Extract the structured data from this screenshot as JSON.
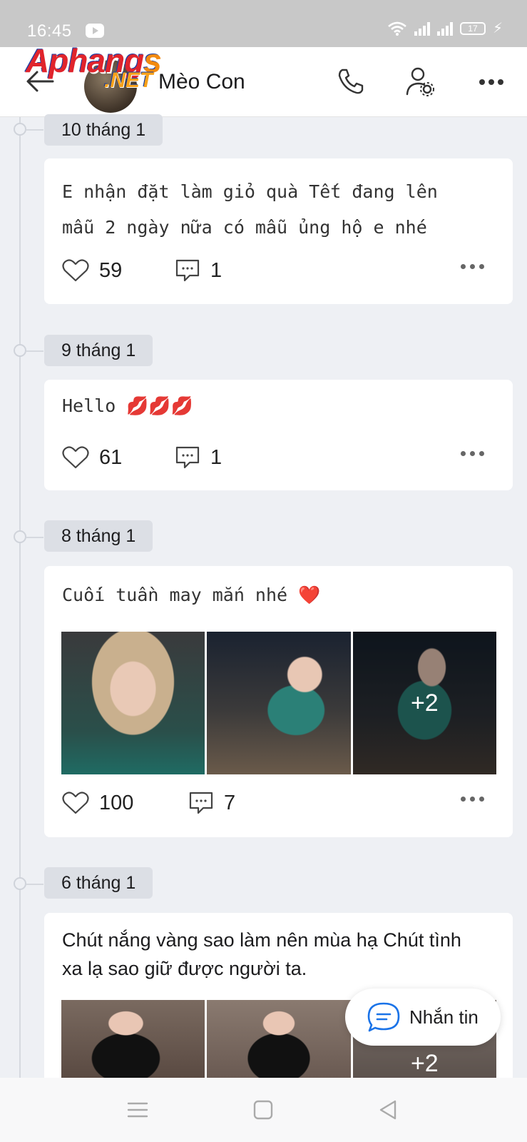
{
  "status_bar": {
    "time": "16:45",
    "battery": "17",
    "icons": [
      "youtube-icon",
      "wifi-icon",
      "signal-icon",
      "signal-icon",
      "battery-icon",
      "charging-icon"
    ]
  },
  "header": {
    "profile_name": "Mèo Con",
    "icons": [
      "back-arrow-icon",
      "phone-icon",
      "user-settings-icon",
      "more-icon"
    ]
  },
  "watermark": {
    "main": "Aphang",
    "s": "s",
    "net": ".NET"
  },
  "posts": [
    {
      "date": "10 tháng 1",
      "text": "E nhận đặt làm giỏ quà Tết đang lên\nmẫu 2 ngày nữa có mẫu ủng hộ e nhé",
      "likes": "59",
      "comments": "1"
    },
    {
      "date": "9 tháng 1",
      "text": "Hello 💋💋💋",
      "likes": "61",
      "comments": "1"
    },
    {
      "date": "8 tháng 1",
      "text": "Cuối tuần may mắn nhé ❤️",
      "likes": "100",
      "comments": "7",
      "more_photos": "+2"
    },
    {
      "date": "6 tháng 1",
      "text": "Chút nắng vàng sao làm nên mùa hạ Chút tình xa lạ sao giữ được người ta.",
      "more_photos": "+2"
    }
  ],
  "fab": {
    "label": "Nhắn tin",
    "icon": "chat-bubble-icon"
  },
  "nav_bar": {
    "icons": [
      "menu-icon",
      "home-square-icon",
      "back-triangle-icon"
    ]
  },
  "colors": {
    "background": "#eef0f4",
    "card": "#ffffff",
    "date_pill": "#dcdfe5",
    "accent_blue": "#1a73e8",
    "status_bar": "#c8c8c8"
  }
}
